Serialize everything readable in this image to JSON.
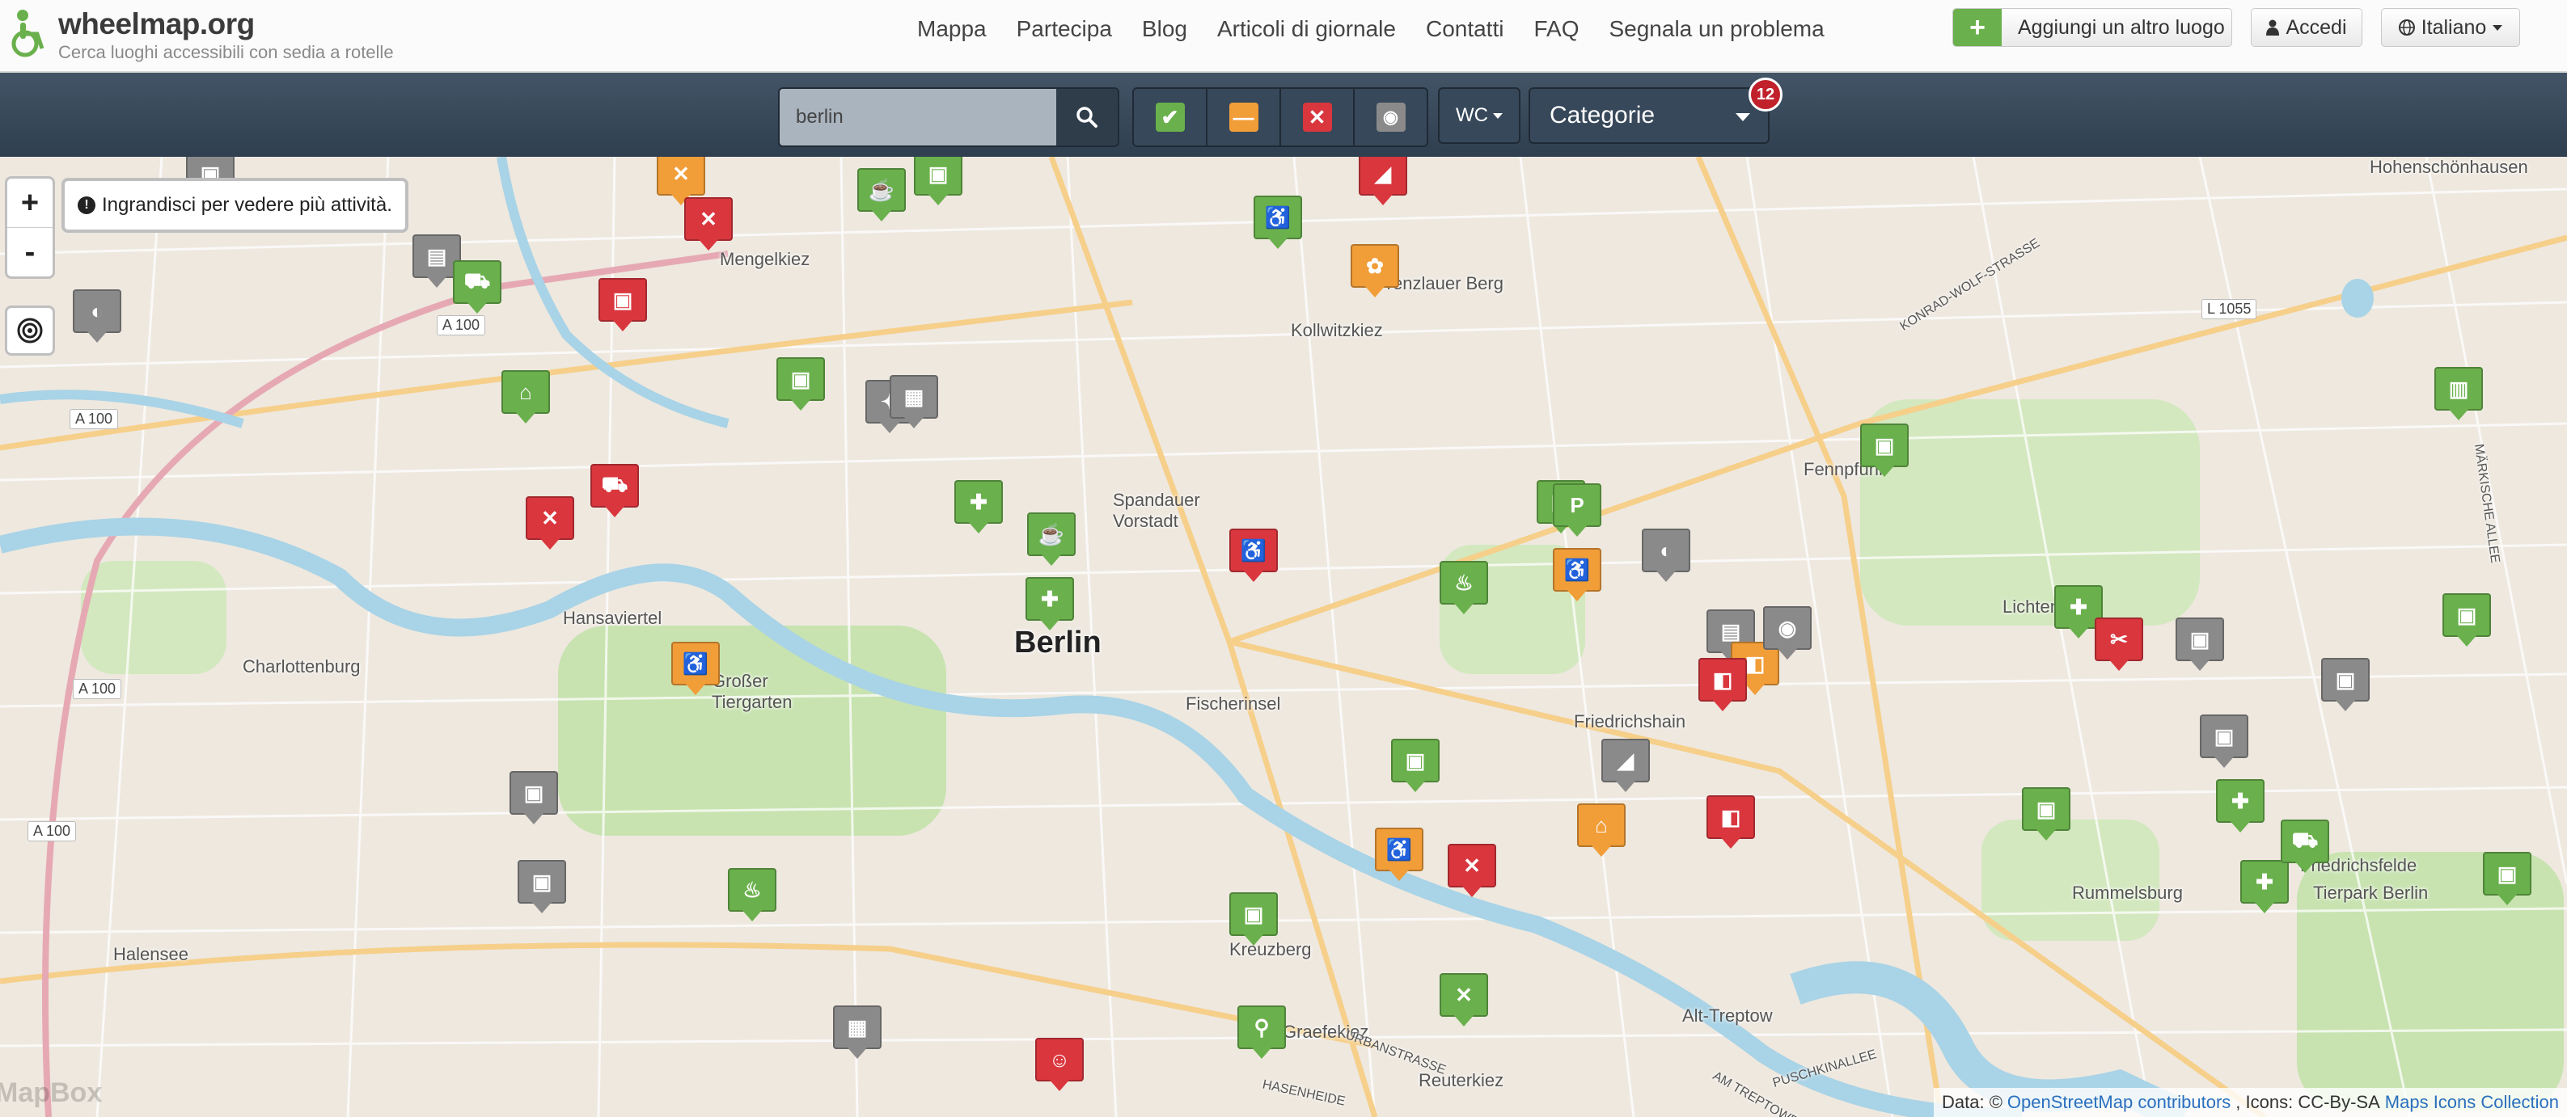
{
  "header": {
    "brand": "wheelmap.org",
    "tagline": "Cerca luoghi accessibili con sedia a rotelle",
    "nav": [
      "Mappa",
      "Partecipa",
      "Blog",
      "Articoli di giornale",
      "Contatti",
      "FAQ",
      "Segnala un problema"
    ],
    "add_button": "Aggiungi un altro luogo",
    "login_button": "Accedi",
    "language_button": "Italiano"
  },
  "toolbar": {
    "search_value": "berlin",
    "filters": [
      {
        "name": "filter-yes",
        "color": "#6ab04c",
        "glyph": "✔"
      },
      {
        "name": "filter-limited",
        "color": "#f19d38",
        "glyph": "—"
      },
      {
        "name": "filter-no",
        "color": "#d9363e",
        "glyph": "✕"
      },
      {
        "name": "filter-unknown",
        "color": "#8a8a8a",
        "glyph": "◉"
      }
    ],
    "wc_label": "WC",
    "category_label": "Categorie",
    "category_count": "12"
  },
  "map": {
    "zoom_in": "+",
    "zoom_out": "-",
    "zoom_hint": "Ingrandisci per vedere più attività.",
    "labels": [
      "Berlin",
      "Charlottenburg",
      "Hansaviertel",
      "Großer Tiergarten",
      "Fischerinsel",
      "Prenzlauer Berg",
      "Kollwitzkiez",
      "Spandauer Vorstadt",
      "Friedrichshain",
      "Rummelsburg",
      "Friedrichsfelde",
      "Tierpark Berlin",
      "Halensee",
      "Graefekiez",
      "Reuterkiez",
      "Alt-Treptow",
      "Lichtenberg",
      "Mengelkiez",
      "Kreuzberg",
      "Hohenschönhausen",
      "Fennpfuhl"
    ],
    "road_shields": [
      "A 100",
      "A 100",
      "A 100",
      "A 100",
      "L 1055"
    ],
    "road_names": [
      "KONRAD-WOLF-STRASSE",
      "MÄRKISCHE ALLEE",
      "URBANSTRASSE",
      "HASENHEIDE",
      "PUSCHKINALLEE",
      "AM TREPTOWER"
    ],
    "watermark": "MapBox",
    "attribution_prefix": "Data: ©",
    "attribution_osm": "OpenStreetMap contributors",
    "attribution_icons": ", Icons: CC-By-SA",
    "attribution_maki": "Maps Icons Collection"
  },
  "colors": {
    "accessible": "#6ab04c",
    "limited": "#f19d38",
    "not_accessible": "#d9363e",
    "unknown": "#8a8a8a",
    "water": "#a9d3e6",
    "park": "#c8e3b0"
  },
  "markers": [
    {
      "status": "unknown",
      "icon": "bus-icon",
      "glyph": "▣"
    },
    {
      "status": "limited",
      "icon": "restaurant-icon",
      "glyph": "✕"
    },
    {
      "status": "not_accessible",
      "icon": "restaurant-icon",
      "glyph": "✕"
    },
    {
      "status": "accessible",
      "icon": "cafe-icon",
      "glyph": "☕"
    },
    {
      "status": "accessible",
      "icon": "bus-icon",
      "glyph": "▣"
    },
    {
      "status": "not_accessible",
      "icon": "shoe-icon",
      "glyph": "◢"
    },
    {
      "status": "accessible",
      "icon": "toilet-icon",
      "glyph": "♿"
    },
    {
      "status": "limited",
      "icon": "florist-icon",
      "glyph": "✿"
    },
    {
      "status": "unknown",
      "icon": "atm-icon",
      "glyph": "▤"
    },
    {
      "status": "accessible",
      "icon": "shopping-icon",
      "glyph": "⛟"
    },
    {
      "status": "not_accessible",
      "icon": "train-icon",
      "glyph": "▣"
    },
    {
      "status": "unknown",
      "icon": "bakery-icon",
      "glyph": "◐"
    },
    {
      "status": "accessible",
      "icon": "playground-icon",
      "glyph": "⌂"
    },
    {
      "status": "accessible",
      "icon": "bus-icon",
      "glyph": "▣"
    },
    {
      "status": "unknown",
      "icon": "sport-icon",
      "glyph": "✦"
    },
    {
      "status": "unknown",
      "icon": "gallery-icon",
      "glyph": "▦"
    },
    {
      "status": "not_accessible",
      "icon": "shopping-icon",
      "glyph": "⛟"
    },
    {
      "status": "not_accessible",
      "icon": "restaurant-icon",
      "glyph": "✕"
    },
    {
      "status": "accessible",
      "icon": "pharmacy-icon",
      "glyph": "✚"
    },
    {
      "status": "accessible",
      "icon": "cafe-icon",
      "glyph": "☕"
    },
    {
      "status": "accessible",
      "icon": "pharmacy-icon",
      "glyph": "✚"
    },
    {
      "status": "not_accessible",
      "icon": "toilet-icon",
      "glyph": "♿"
    },
    {
      "status": "accessible",
      "icon": "drink-icon",
      "glyph": "♨"
    },
    {
      "status": "limited",
      "icon": "toilet-icon",
      "glyph": "♿"
    },
    {
      "status": "unknown",
      "icon": "bakery-icon",
      "glyph": "◐"
    },
    {
      "status": "unknown",
      "icon": "atm-icon",
      "glyph": "▤"
    },
    {
      "status": "accessible",
      "icon": "bus-icon",
      "glyph": "▣"
    },
    {
      "status": "not_accessible",
      "icon": "restaurant-icon",
      "glyph": "✕"
    },
    {
      "status": "accessible",
      "icon": "pharmacy-icon",
      "glyph": "✚"
    },
    {
      "status": "unknown",
      "icon": "bus-icon",
      "glyph": "▣"
    },
    {
      "status": "limited",
      "icon": "beer-icon",
      "glyph": "◧"
    },
    {
      "status": "not_accessible",
      "icon": "beer-icon",
      "glyph": "◧"
    },
    {
      "status": "accessible",
      "icon": "parking-icon",
      "glyph": "P"
    },
    {
      "status": "unknown",
      "icon": "photo-icon",
      "glyph": "◉"
    },
    {
      "status": "accessible",
      "icon": "bus-icon",
      "glyph": "▣"
    },
    {
      "status": "unknown",
      "icon": "shoe-icon",
      "glyph": "◢"
    },
    {
      "status": "limited",
      "icon": "playground-icon",
      "glyph": "⌂"
    },
    {
      "status": "accessible",
      "icon": "pharmacy-icon",
      "glyph": "✚"
    },
    {
      "status": "unknown",
      "icon": "bus-icon",
      "glyph": "▣"
    },
    {
      "status": "accessible",
      "icon": "train-icon",
      "glyph": "▣"
    },
    {
      "status": "not_accessible",
      "icon": "scissors-icon",
      "glyph": "✂"
    },
    {
      "status": "unknown",
      "icon": "bus-icon",
      "glyph": "▣"
    },
    {
      "status": "accessible",
      "icon": "pharmacy-icon",
      "glyph": "✚"
    },
    {
      "status": "accessible",
      "icon": "bus-icon",
      "glyph": "▣"
    },
    {
      "status": "limited",
      "icon": "toilet-icon",
      "glyph": "♿"
    },
    {
      "status": "not_accessible",
      "icon": "restaurant-icon",
      "glyph": "✕"
    },
    {
      "status": "accessible",
      "icon": "bicycle-icon",
      "glyph": "⚲"
    },
    {
      "status": "unknown",
      "icon": "gallery-icon",
      "glyph": "▦"
    },
    {
      "status": "not_accessible",
      "icon": "theatre-icon",
      "glyph": "☺"
    },
    {
      "status": "accessible",
      "icon": "restaurant-icon",
      "glyph": "✕"
    },
    {
      "status": "limited",
      "icon": "toilet-icon",
      "glyph": "♿"
    },
    {
      "status": "accessible",
      "icon": "shopping-icon",
      "glyph": "⛟"
    },
    {
      "status": "unknown",
      "icon": "bus-icon",
      "glyph": "▣"
    },
    {
      "status": "accessible",
      "icon": "drink-icon",
      "glyph": "♨"
    },
    {
      "status": "not_accessible",
      "icon": "beer-icon",
      "glyph": "◧"
    },
    {
      "status": "accessible",
      "icon": "bus-icon",
      "glyph": "▣"
    },
    {
      "status": "unknown",
      "icon": "bus-icon",
      "glyph": "▣"
    },
    {
      "status": "accessible",
      "icon": "train-icon",
      "glyph": "▣"
    },
    {
      "status": "accessible",
      "icon": "clothes-icon",
      "glyph": "▥"
    },
    {
      "status": "accessible",
      "icon": "train-icon",
      "glyph": "▣"
    }
  ]
}
